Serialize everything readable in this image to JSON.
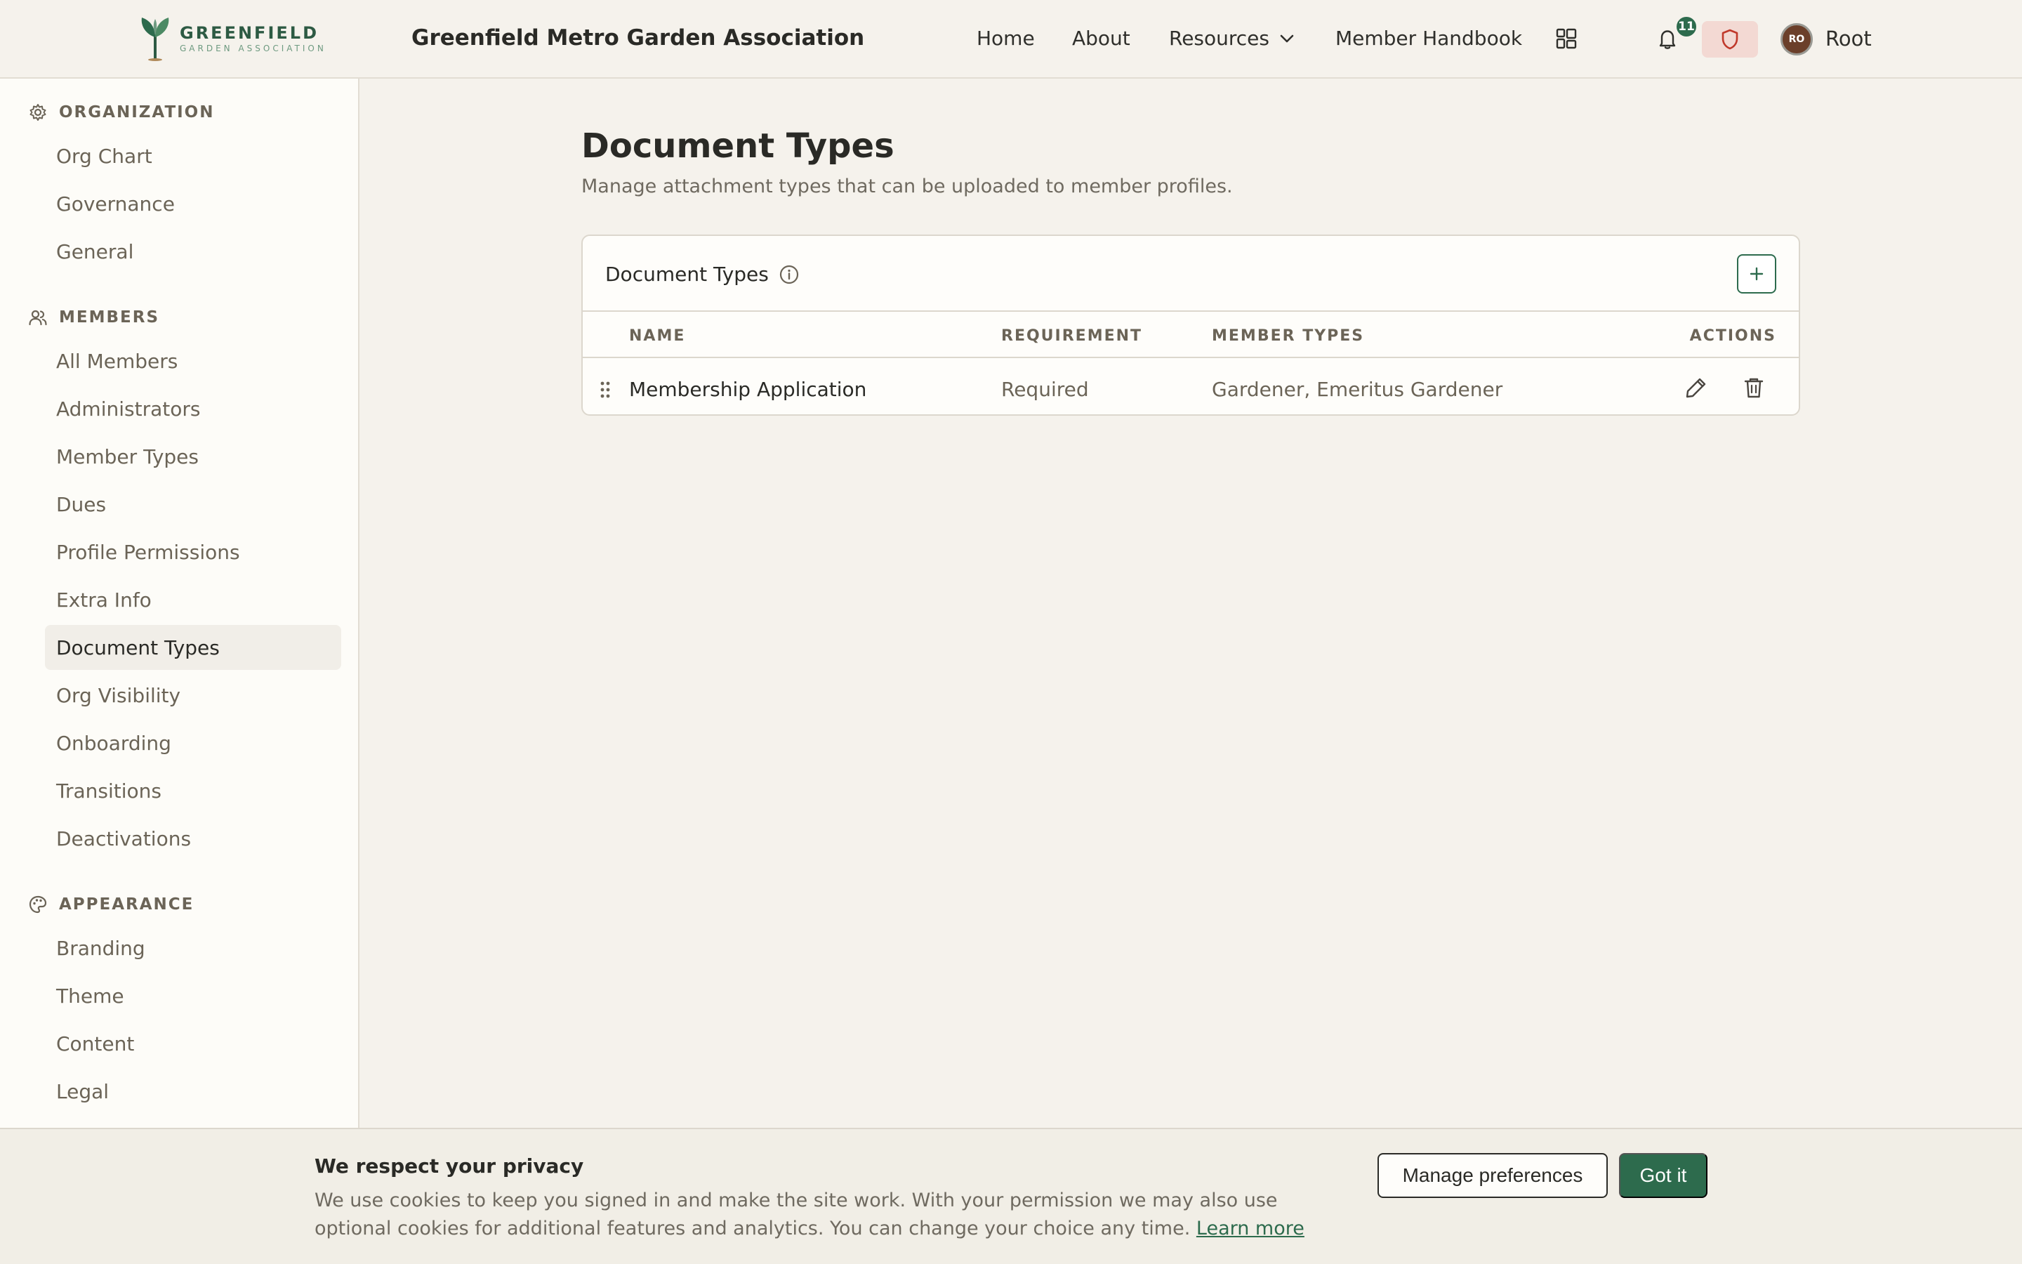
{
  "header": {
    "logo_main": "GREENFIELD",
    "logo_sub": "GARDEN ASSOCIATION",
    "org_title": "Greenfield Metro Garden Association",
    "nav": {
      "home": "Home",
      "about": "About",
      "resources": "Resources",
      "handbook": "Member Handbook"
    },
    "notification_count": "11",
    "avatar_initials": "RO",
    "user_name": "Root"
  },
  "sidebar": {
    "organization": {
      "heading": "ORGANIZATION",
      "items": [
        "Org Chart",
        "Governance",
        "General"
      ]
    },
    "members": {
      "heading": "MEMBERS",
      "items": [
        "All Members",
        "Administrators",
        "Member Types",
        "Dues",
        "Profile Permissions",
        "Extra Info",
        "Document Types",
        "Org Visibility",
        "Onboarding",
        "Transitions",
        "Deactivations"
      ]
    },
    "appearance": {
      "heading": "APPEARANCE",
      "items": [
        "Branding",
        "Theme",
        "Content",
        "Legal"
      ]
    }
  },
  "main": {
    "title": "Document Types",
    "subtitle": "Manage attachment types that can be uploaded to member profiles.",
    "card_title": "Document Types",
    "columns": {
      "name": "NAME",
      "requirement": "REQUIREMENT",
      "member_types": "MEMBER TYPES",
      "actions": "ACTIONS"
    },
    "rows": [
      {
        "name": "Membership Application",
        "requirement": "Required",
        "member_types": "Gardener, Emeritus Gardener"
      }
    ]
  },
  "cookie": {
    "title": "We respect your privacy",
    "text": "We use cookies to keep you signed in and make the site work. With your permission we may also use optional cookies for additional features and analytics. You can change your choice any time.",
    "learn_more": "Learn more",
    "manage": "Manage preferences",
    "accept": "Got it"
  },
  "colors": {
    "brand_green": "#2d6b4d",
    "page_bg": "#f5f2ec",
    "sidebar_bg": "#fdfcf8",
    "shield_bg": "#f3d9d3",
    "shield_red": "#c0392b"
  }
}
